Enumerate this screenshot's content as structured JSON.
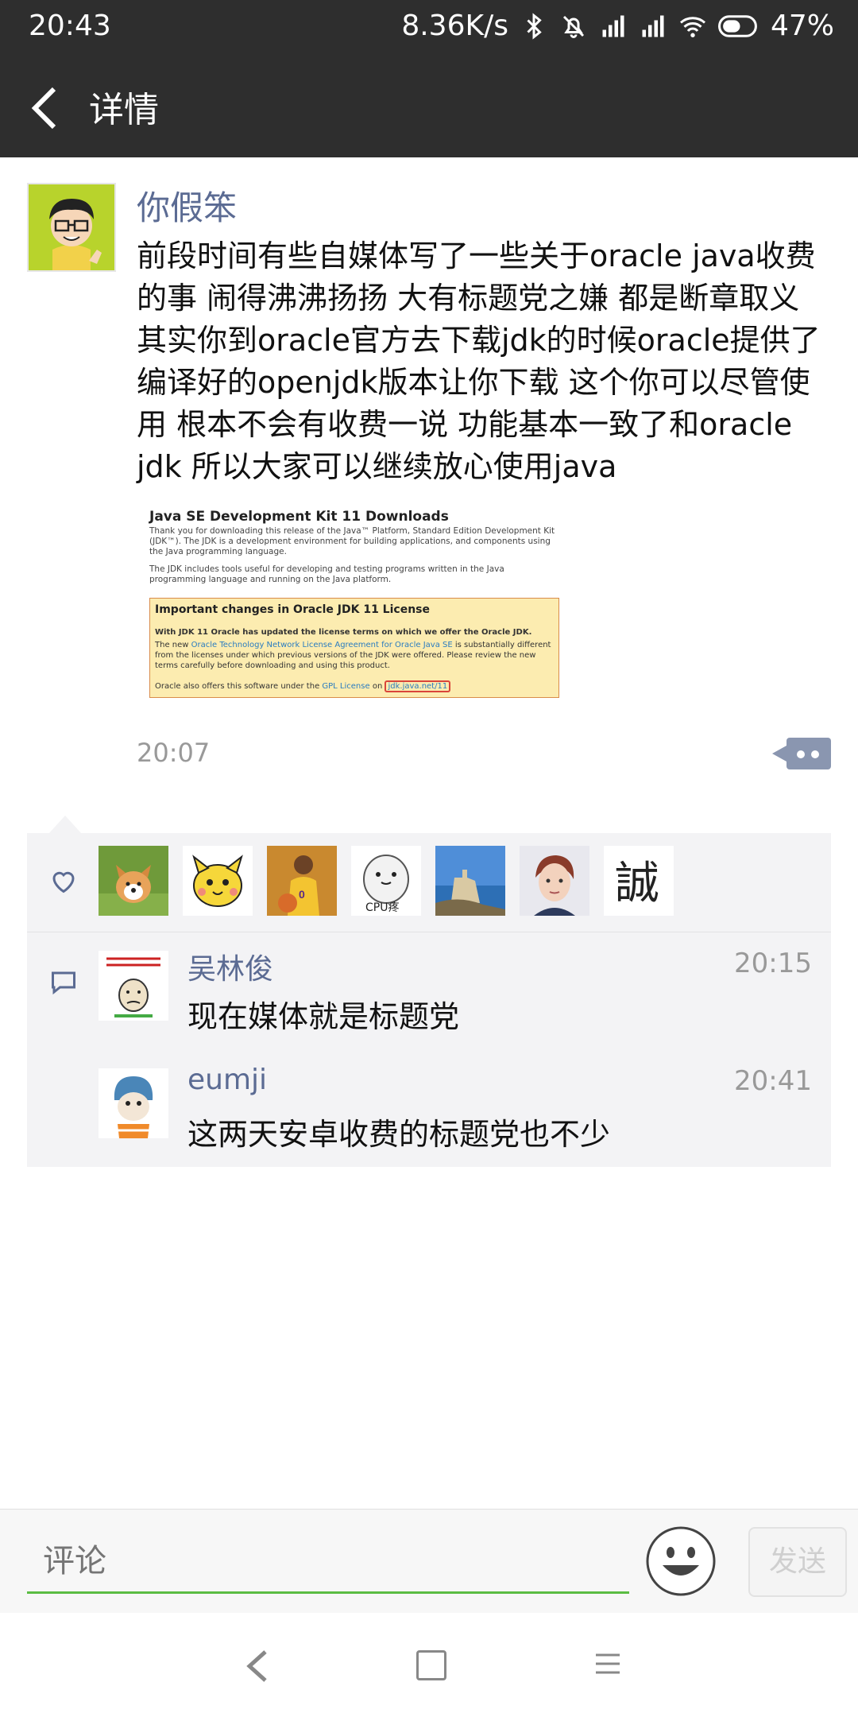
{
  "status_bar": {
    "time": "20:43",
    "net_speed": "8.36K/s",
    "battery": "47%",
    "icons": [
      "bluetooth-icon",
      "mute-icon",
      "signal-icon",
      "signal-icon",
      "wifi-icon",
      "battery-icon"
    ]
  },
  "header": {
    "title": "详情",
    "back_icon": "chevron-left-icon"
  },
  "post": {
    "author": "你假笨",
    "content": "前段时间有些自媒体写了一些关于oracle java收费\n的事 闹得沸沸扬扬 大有标题党之嫌 都是断章取义\n其实你到oracle官方去下载jdk的时候oracle提供了\n编译好的openjdk版本让你下载 这个你可以尽管使\n用 根本不会有收费一说 功能基本一致了和oracle\njdk 所以大家可以继续放心使用java",
    "time": "20:07",
    "image": {
      "heading": "Java SE Development Kit 11 Downloads",
      "para1": "Thank you for downloading this release of the Java™ Platform, Standard Edition Development Kit (JDK™). The JDK is a development environment for building applications, and components using the Java programming language.",
      "para2": "The JDK includes tools useful for developing and testing programs written in the Java programming language and running on the Java platform.",
      "box_heading": "Important changes in Oracle JDK 11 License",
      "box_line1": "With JDK 11 Oracle has updated the license terms on which we offer the Oracle JDK.",
      "box_line2_pre": "The new ",
      "box_line2_link": "Oracle Technology Network License Agreement for Oracle Java SE",
      "box_line2_post": " is substantially different from the licenses under which previous versions of the JDK were offered. Please review the new terms carefully before downloading and using this product.",
      "box_line3_pre": "Oracle also offers this software under the ",
      "box_line3_link": "GPL License",
      "box_line3_mid": " on ",
      "box_line3_link2": "jdk.java.net/11"
    }
  },
  "likes": {
    "icon": "heart-icon",
    "avatars": [
      "puppy-avatar",
      "yellow-cartoon-avatar",
      "basketball-player-avatar",
      "cpu-meme-avatar",
      "castle-photo-avatar",
      "anime-man-avatar",
      "calligraphy-avatar"
    ],
    "cpu_label": "CPU疼",
    "calligraphy_char": "誠"
  },
  "comments": {
    "icon": "comment-icon",
    "items": [
      {
        "name": "吴林俊",
        "time": "20:15",
        "text": "现在媒体就是标题党"
      },
      {
        "name": "eumji",
        "time": "20:41",
        "text": "这两天安卓收费的标题党也不少"
      }
    ]
  },
  "comment_bar": {
    "placeholder": "评论",
    "send_label": "发送"
  },
  "colors": {
    "header_bg": "#2e2e2e",
    "name_color": "#5b6b93",
    "input_underline": "#5bbd43"
  }
}
